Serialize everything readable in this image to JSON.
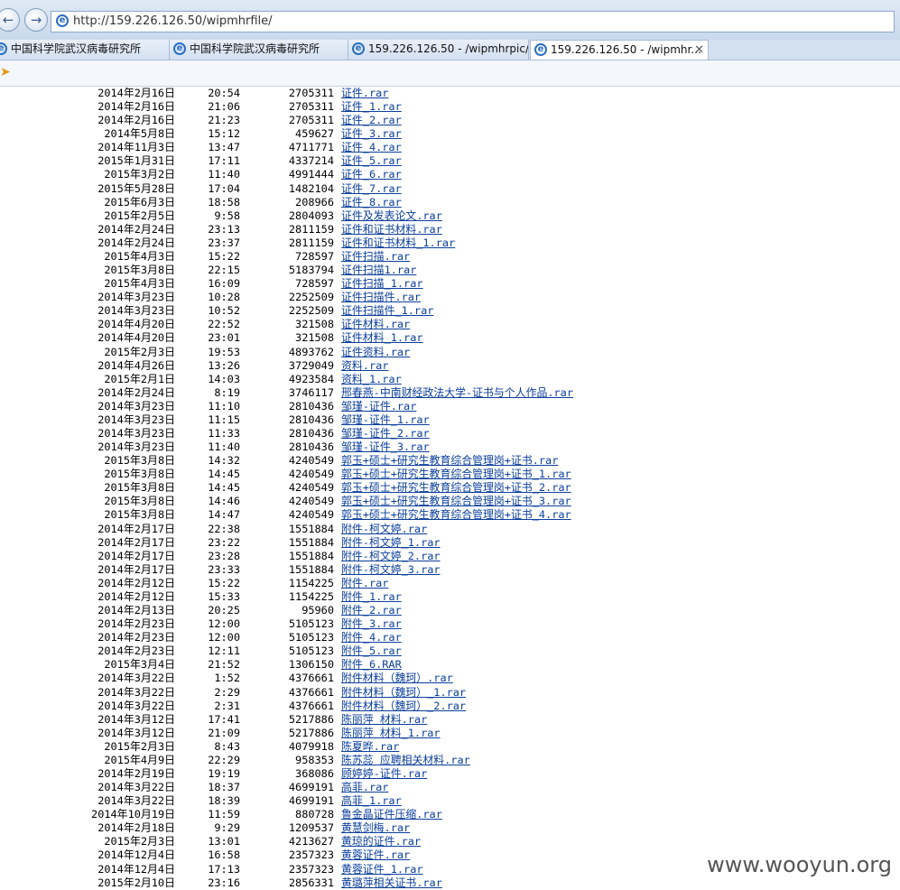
{
  "browser": {
    "address": "http://159.226.126.50/wipmhrfile/",
    "tabs": [
      {
        "label": "中国科学院武汉病毒研究所"
      },
      {
        "label": "中国科学院武汉病毒研究所"
      },
      {
        "label": "159.226.126.50 - /wipmhrpic/"
      },
      {
        "label": "159.226.126.50 - /wipmhr..."
      }
    ],
    "back_icon": "back-arrow-icon",
    "forward_icon": "forward-arrow-icon"
  },
  "files": [
    {
      "date": "2014年2月16日",
      "time": "20:54",
      "size": "2705311",
      "name": "证件.rar"
    },
    {
      "date": "2014年2月16日",
      "time": "21:06",
      "size": "2705311",
      "name": "证件_1.rar"
    },
    {
      "date": "2014年2月16日",
      "time": "21:23",
      "size": "2705311",
      "name": "证件_2.rar"
    },
    {
      "date": "2014年5月8日",
      "time": "15:12",
      "size": "459627",
      "name": "证件_3.rar"
    },
    {
      "date": "2014年11月3日",
      "time": "13:47",
      "size": "4711771",
      "name": "证件_4.rar"
    },
    {
      "date": "2015年1月31日",
      "time": "17:11",
      "size": "4337214",
      "name": "证件_5.rar"
    },
    {
      "date": "2015年3月2日",
      "time": "11:40",
      "size": "4991444",
      "name": "证件_6.rar"
    },
    {
      "date": "2015年5月28日",
      "time": "17:04",
      "size": "1482104",
      "name": "证件_7.rar"
    },
    {
      "date": "2015年6月3日",
      "time": "18:58",
      "size": "208966",
      "name": "证件_8.rar"
    },
    {
      "date": "2015年2月5日",
      "time": "9:58",
      "size": "2804093",
      "name": "证件及发表论文.rar"
    },
    {
      "date": "2014年2月24日",
      "time": "23:13",
      "size": "2811159",
      "name": "证件和证书材料.rar"
    },
    {
      "date": "2014年2月24日",
      "time": "23:37",
      "size": "2811159",
      "name": "证件和证书材料_1.rar"
    },
    {
      "date": "2015年4月3日",
      "time": "15:22",
      "size": "728597",
      "name": "证件扫描.rar"
    },
    {
      "date": "2015年3月8日",
      "time": "22:15",
      "size": "5183794",
      "name": "证件扫描1.rar"
    },
    {
      "date": "2015年4月3日",
      "time": "16:09",
      "size": "728597",
      "name": "证件扫描_1.rar"
    },
    {
      "date": "2014年3月23日",
      "time": "10:28",
      "size": "2252509",
      "name": "证件扫描件.rar"
    },
    {
      "date": "2014年3月23日",
      "time": "10:52",
      "size": "2252509",
      "name": "证件扫描件_1.rar"
    },
    {
      "date": "2014年4月20日",
      "time": "22:52",
      "size": "321508",
      "name": "证件材料.rar"
    },
    {
      "date": "2014年4月20日",
      "time": "23:01",
      "size": "321508",
      "name": "证件材料_1.rar"
    },
    {
      "date": "2015年2月3日",
      "time": "19:53",
      "size": "4893762",
      "name": "证件资料.rar"
    },
    {
      "date": "2014年4月26日",
      "time": "13:26",
      "size": "3729049",
      "name": "资料.rar"
    },
    {
      "date": "2015年2月1日",
      "time": "14:03",
      "size": "4923584",
      "name": "资料_1.rar"
    },
    {
      "date": "2014年2月24日",
      "time": "8:19",
      "size": "3746117",
      "name": "邢春燕-中南财经政法大学-证书与个人作品.rar"
    },
    {
      "date": "2014年3月23日",
      "time": "11:10",
      "size": "2810436",
      "name": "邹瑾-证件.rar"
    },
    {
      "date": "2014年3月23日",
      "time": "11:15",
      "size": "2810436",
      "name": "邹瑾-证件_1.rar"
    },
    {
      "date": "2014年3月23日",
      "time": "11:33",
      "size": "2810436",
      "name": "邹瑾-证件_2.rar"
    },
    {
      "date": "2014年3月23日",
      "time": "11:40",
      "size": "2810436",
      "name": "邹瑾-证件_3.rar"
    },
    {
      "date": "2015年3月8日",
      "time": "14:32",
      "size": "4240549",
      "name": "郭玉+硕士+研究生教育综合管理岗+证书.rar"
    },
    {
      "date": "2015年3月8日",
      "time": "14:45",
      "size": "4240549",
      "name": "郭玉+硕士+研究生教育综合管理岗+证书_1.rar"
    },
    {
      "date": "2015年3月8日",
      "time": "14:45",
      "size": "4240549",
      "name": "郭玉+硕士+研究生教育综合管理岗+证书_2.rar"
    },
    {
      "date": "2015年3月8日",
      "time": "14:46",
      "size": "4240549",
      "name": "郭玉+硕士+研究生教育综合管理岗+证书_3.rar"
    },
    {
      "date": "2015年3月8日",
      "time": "14:47",
      "size": "4240549",
      "name": "郭玉+硕士+研究生教育综合管理岗+证书_4.rar"
    },
    {
      "date": "2014年2月17日",
      "time": "22:38",
      "size": "1551884",
      "name": "附件-柯文婷.rar"
    },
    {
      "date": "2014年2月17日",
      "time": "23:22",
      "size": "1551884",
      "name": "附件-柯文婷_1.rar"
    },
    {
      "date": "2014年2月17日",
      "time": "23:28",
      "size": "1551884",
      "name": "附件-柯文婷_2.rar"
    },
    {
      "date": "2014年2月17日",
      "time": "23:33",
      "size": "1551884",
      "name": "附件-柯文婷_3.rar"
    },
    {
      "date": "2014年2月12日",
      "time": "15:22",
      "size": "1154225",
      "name": "附件.rar"
    },
    {
      "date": "2014年2月12日",
      "time": "15:33",
      "size": "1154225",
      "name": "附件_1.rar"
    },
    {
      "date": "2014年2月13日",
      "time": "20:25",
      "size": "95960",
      "name": "附件_2.rar"
    },
    {
      "date": "2014年2月23日",
      "time": "12:00",
      "size": "5105123",
      "name": "附件_3.rar"
    },
    {
      "date": "2014年2月23日",
      "time": "12:00",
      "size": "5105123",
      "name": "附件_4.rar"
    },
    {
      "date": "2014年2月23日",
      "time": "12:11",
      "size": "5105123",
      "name": "附件_5.rar"
    },
    {
      "date": "2015年3月4日",
      "time": "21:52",
      "size": "1306150",
      "name": "附件_6.RAR"
    },
    {
      "date": "2014年3月22日",
      "time": "1:52",
      "size": "4376661",
      "name": "附件材料（魏珂）.rar"
    },
    {
      "date": "2014年3月22日",
      "time": "2:29",
      "size": "4376661",
      "name": "附件材料（魏珂）_1.rar"
    },
    {
      "date": "2014年3月22日",
      "time": "2:31",
      "size": "4376661",
      "name": "附件材料（魏珂）_2.rar"
    },
    {
      "date": "2014年3月12日",
      "time": "17:41",
      "size": "5217886",
      "name": "陈丽萍 材料.rar"
    },
    {
      "date": "2014年3月12日",
      "time": "21:09",
      "size": "5217886",
      "name": "陈丽萍 材料_1.rar"
    },
    {
      "date": "2015年2月3日",
      "time": "8:43",
      "size": "4079918",
      "name": "陈夏晔.rar"
    },
    {
      "date": "2015年4月9日",
      "time": "22:29",
      "size": "958353",
      "name": "陈苏蕊 应聘相关材料.rar"
    },
    {
      "date": "2014年2月19日",
      "time": "19:19",
      "size": "368086",
      "name": "顾婷婷-证件.rar"
    },
    {
      "date": "2014年3月22日",
      "time": "18:37",
      "size": "4699191",
      "name": "高菲.rar"
    },
    {
      "date": "2014年3月22日",
      "time": "18:39",
      "size": "4699191",
      "name": "高菲_1.rar"
    },
    {
      "date": "2014年10月19日",
      "time": "11:59",
      "size": "880728",
      "name": "鲁金晶证件压缩.rar"
    },
    {
      "date": "2014年2月18日",
      "time": "9:29",
      "size": "1209537",
      "name": "黄慧剑梅.rar"
    },
    {
      "date": "2015年2月3日",
      "time": "13:01",
      "size": "4213627",
      "name": "黄琼的证件.rar"
    },
    {
      "date": "2014年12月4日",
      "time": "16:58",
      "size": "2357323",
      "name": "黄蓉证件.rar"
    },
    {
      "date": "2014年12月4日",
      "time": "17:13",
      "size": "2357323",
      "name": "黄蓉证件_1.rar"
    },
    {
      "date": "2015年2月10日",
      "time": "23:16",
      "size": "2856331",
      "name": "黄璐萍相关证书.rar"
    }
  ],
  "watermark": "www.wooyun.org"
}
